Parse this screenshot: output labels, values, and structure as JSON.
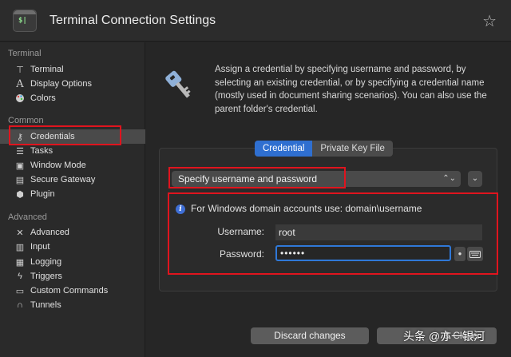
{
  "window": {
    "title": "Terminal Connection Settings",
    "app_icon_glyph": "$|",
    "favorite_icon": "star-icon"
  },
  "sidebar": {
    "sections": [
      {
        "title": "Terminal",
        "items": [
          {
            "label": "Terminal",
            "icon": "terminal-icon"
          },
          {
            "label": "Display Options",
            "icon": "font-icon"
          },
          {
            "label": "Colors",
            "icon": "palette-icon"
          }
        ]
      },
      {
        "title": "Common",
        "items": [
          {
            "label": "Credentials",
            "icon": "key-icon",
            "selected": true
          },
          {
            "label": "Tasks",
            "icon": "tasks-icon"
          },
          {
            "label": "Window Mode",
            "icon": "window-icon"
          },
          {
            "label": "Secure Gateway",
            "icon": "gateway-icon"
          },
          {
            "label": "Plugin",
            "icon": "plugin-icon"
          }
        ]
      },
      {
        "title": "Advanced",
        "items": [
          {
            "label": "Advanced",
            "icon": "tools-icon"
          },
          {
            "label": "Input",
            "icon": "input-icon"
          },
          {
            "label": "Logging",
            "icon": "logging-icon"
          },
          {
            "label": "Triggers",
            "icon": "trigger-icon"
          },
          {
            "label": "Custom Commands",
            "icon": "command-icon"
          },
          {
            "label": "Tunnels",
            "icon": "tunnel-icon"
          }
        ]
      }
    ]
  },
  "main": {
    "description": "Assign a credential by specifying username and password, by selecting an existing credential, or by specifying a credential name (mostly used in document sharing scenarios). You can also use the parent folder's credential.",
    "tabs": [
      {
        "label": "Credential",
        "active": true
      },
      {
        "label": "Private Key File",
        "active": false
      }
    ],
    "mode_select": {
      "value": "Specify username and password"
    },
    "info_text": "For Windows domain accounts use: domain\\username",
    "username": {
      "label": "Username:",
      "value": "root"
    },
    "password": {
      "label": "Password:",
      "value": "••••••"
    }
  },
  "footer": {
    "discard_label": "Discard changes",
    "close_label": "& Close"
  },
  "watermark": "头条 @亦一银河",
  "colors": {
    "accent": "#2f6fd0",
    "highlight_box": "#e0141e"
  }
}
